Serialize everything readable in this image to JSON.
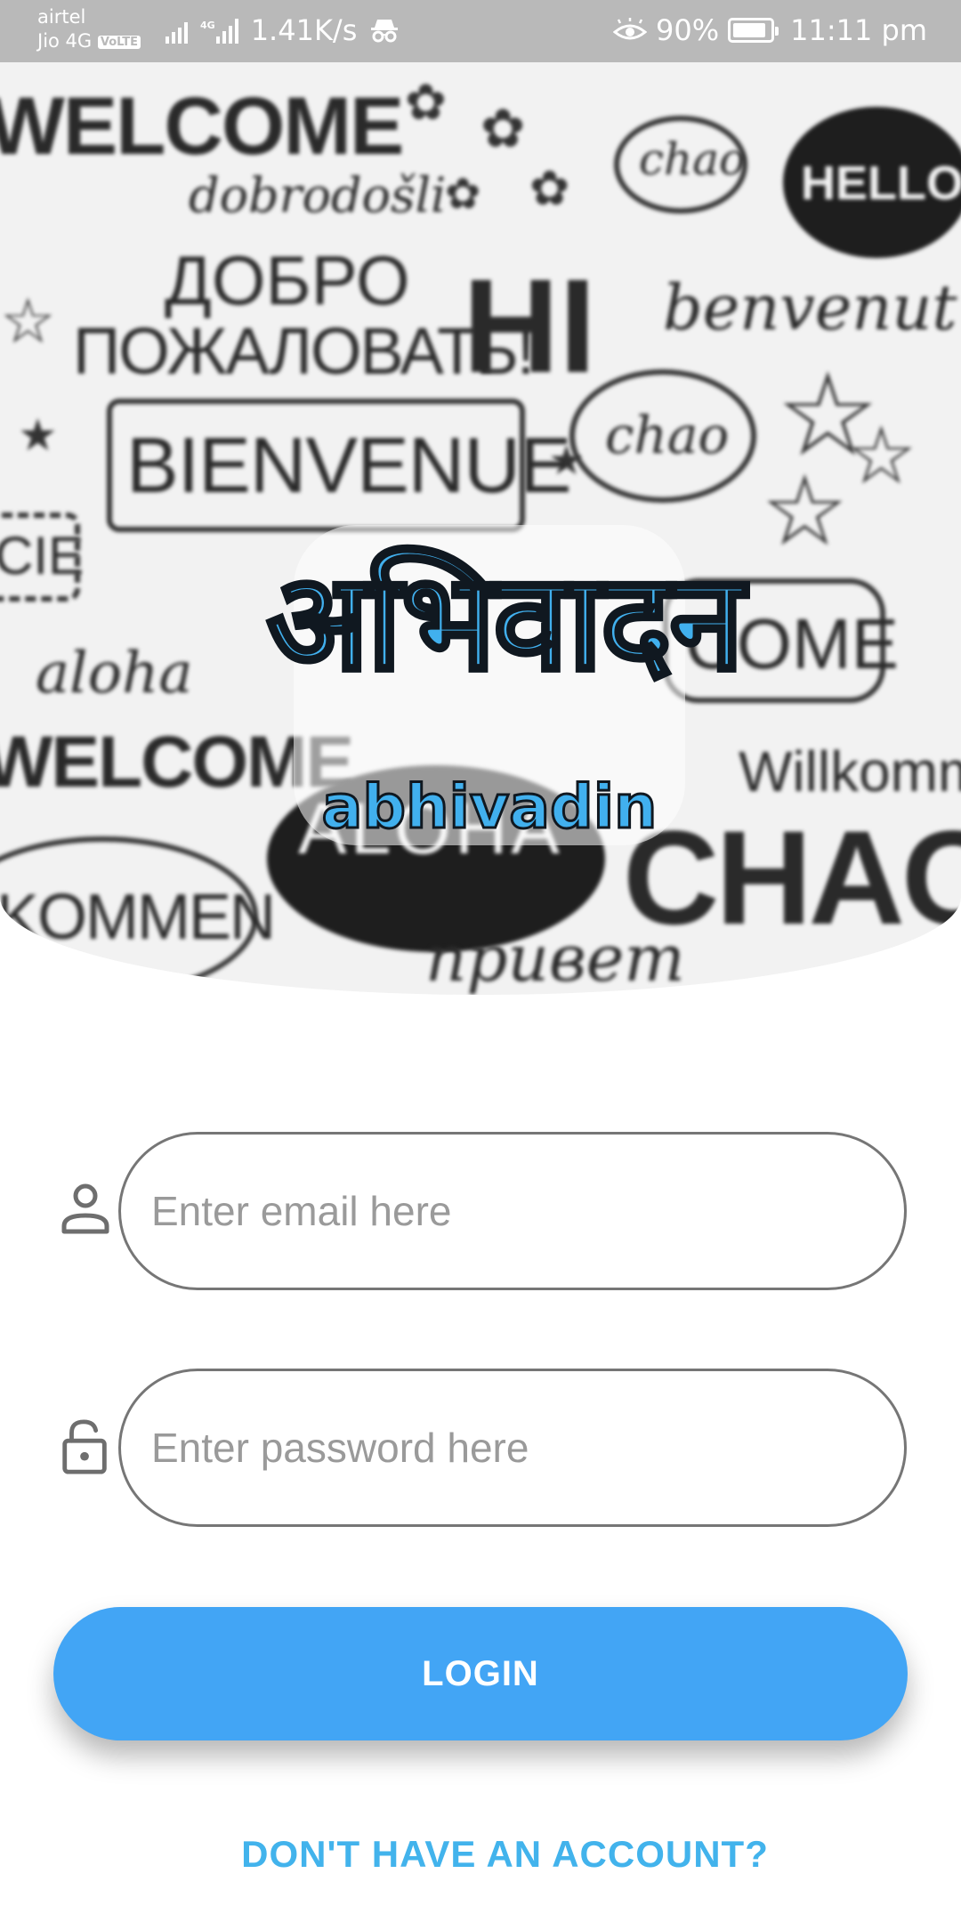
{
  "status_bar": {
    "carrier_1": "airtel",
    "carrier_2": "Jio 4G",
    "volte_badge": "VoLTE",
    "network_label": "4G",
    "speed": "1.41K/s",
    "battery": "90%",
    "time": "11:11 pm",
    "battery_level": 0.9
  },
  "hero": {
    "logo_script": "अभिवादन",
    "app_name": "abhivadin",
    "doodle_words": {
      "welcome_top": "WELCOME",
      "dobrodosli": "dobrodošli",
      "dobro": "ДОБРО",
      "pozhalovat": "ПОЖАЛОВАТЬ!",
      "hi": "HI",
      "hello": "HELLO",
      "chao_cloud": "chao",
      "benvenuti": "benvenut",
      "bienvenue": "BIENVENUE",
      "chao_bubble": "chao",
      "cie": "CIE",
      "aloha_script": "aloha",
      "come": "COME",
      "welcome_bottom": "WELCOME",
      "willkommen": "Willkomm",
      "aloha": "ALOHA",
      "chao": "CHAO",
      "kommen": "KOMMEN",
      "privet": "привет"
    }
  },
  "form": {
    "email_placeholder": "Enter email here",
    "password_placeholder": "Enter password here",
    "login_label": "LOGIN",
    "signup_link": "DON'T HAVE AN ACCOUNT?"
  },
  "colors": {
    "accent": "#42a5f5",
    "link": "#42b3ec",
    "status_bar": "#b9b9b9"
  },
  "icons": {
    "email_field_icon": "person-icon",
    "password_field_icon": "lock-open-icon"
  }
}
